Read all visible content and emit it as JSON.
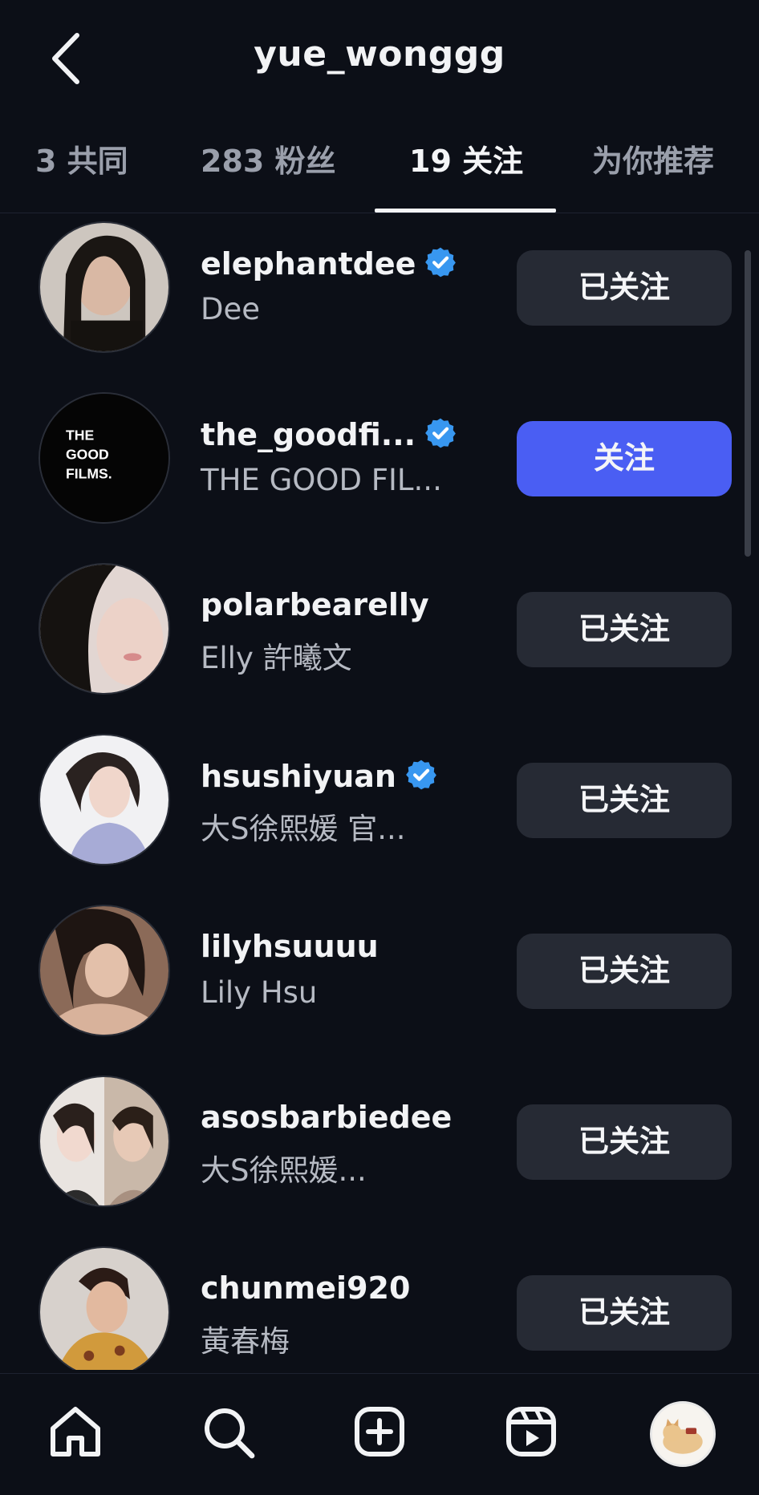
{
  "header": {
    "title": "yue_wonggg",
    "back_icon": "chevron-left-icon"
  },
  "tabs": [
    {
      "label": "3 共同",
      "active": false
    },
    {
      "label": "283 粉丝",
      "active": false
    },
    {
      "label": "19 关注",
      "active": true
    },
    {
      "label": "为你推荐",
      "active": false
    }
  ],
  "accounts": [
    {
      "username": "elephantdee",
      "verified": true,
      "full_name": "Dee",
      "button": "已关注"
    },
    {
      "username": "the_goodfi...",
      "verified": true,
      "full_name": "THE GOOD FIL...",
      "button": "关注",
      "avatar_text": [
        "THE",
        "GOOD",
        "FILMS."
      ]
    },
    {
      "username": "polarbearelly",
      "verified": false,
      "full_name": "Elly 許曦文",
      "button": "已关注"
    },
    {
      "username": "hsushiyuan",
      "verified": true,
      "full_name": "大S徐熙媛 官...",
      "button": "已关注"
    },
    {
      "username": "lilyhsuuuu",
      "verified": false,
      "full_name": "Lily Hsu",
      "button": "已关注"
    },
    {
      "username": "asosbarbiedee",
      "verified": false,
      "full_name": "大S徐熙媛...",
      "button": "已关注"
    },
    {
      "username": "chunmei920",
      "verified": false,
      "full_name": "黃春梅",
      "button": "已关注"
    }
  ],
  "bottom_nav": [
    "home-icon",
    "search-icon",
    "create-icon",
    "reels-icon",
    "profile-avatar"
  ],
  "colors": {
    "background": "#0c0f17",
    "button": "#262a34",
    "primary": "#4a5ef3",
    "verified": "#3897f0"
  }
}
